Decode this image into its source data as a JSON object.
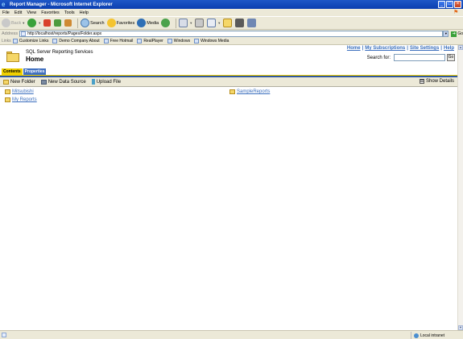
{
  "window": {
    "title": "Report Manager - Microsoft Internet Explorer"
  },
  "menubar": {
    "items": [
      "File",
      "Edit",
      "View",
      "Favorites",
      "Tools",
      "Help"
    ]
  },
  "toolbar": {
    "back": "Back",
    "search": "Search",
    "favorites": "Favorites",
    "media": "Media"
  },
  "addressbar": {
    "label": "Address",
    "url": "http://localhost/reports/Pages/Folder.aspx",
    "go": "Go"
  },
  "linksbar": {
    "label": "Links",
    "items": [
      "Customize Links",
      "Demo Company About",
      "Free Hotmail",
      "RealPlayer",
      "Windows",
      "Windows Media"
    ]
  },
  "page": {
    "toplinks": [
      "Home",
      "My Subscriptions",
      "Site Settings",
      "Help"
    ],
    "separator": "|",
    "search_label": "Search for:",
    "search_go": "Go",
    "subtitle": "SQL Server Reporting Services",
    "title": "Home",
    "tabs": [
      "Contents",
      "Properties"
    ],
    "actions": {
      "new_folder": "New Folder",
      "new_data_source": "New Data Source",
      "upload_file": "Upload File",
      "show_details": "Show Details"
    },
    "items": [
      "Mitsubishi",
      "SampleReports",
      "My Reports"
    ]
  },
  "statusbar": {
    "zone": "Local intranet"
  },
  "colors": {
    "titlebar": "#1e57c7",
    "link": "#3a6ebd",
    "tab_active": "#f0d000",
    "tab_inactive": "#4070c0",
    "chrome": "#ece9d8"
  }
}
